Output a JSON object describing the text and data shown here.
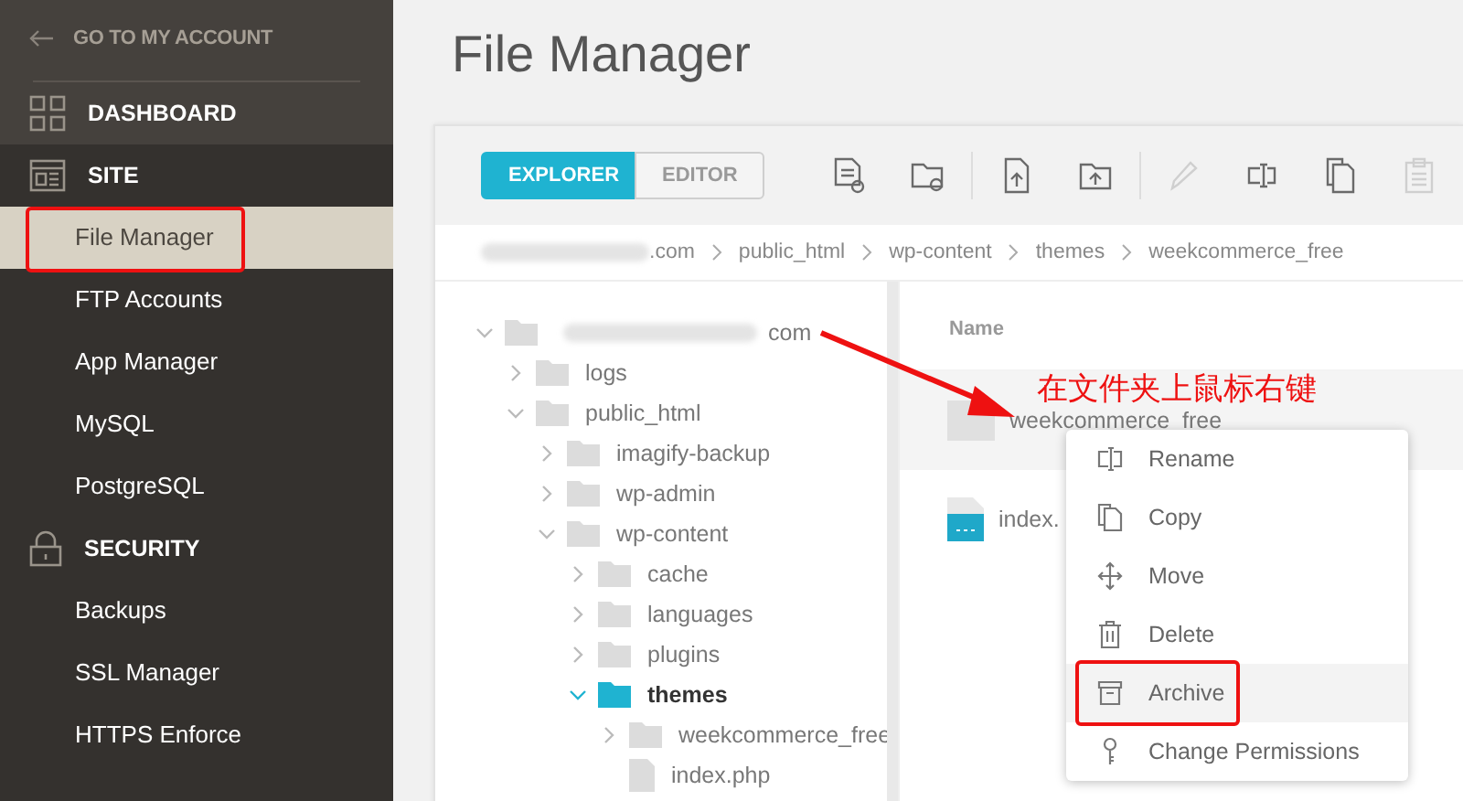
{
  "sidebar": {
    "back_link": "GO TO MY ACCOUNT",
    "top_item": {
      "label": "DASHBOARD",
      "kind": "grid"
    },
    "sections": [
      {
        "label": "SITE",
        "kind": "site",
        "items": [
          {
            "label": "File Manager",
            "selected": true,
            "annotated": true
          },
          {
            "label": "FTP Accounts",
            "selected": false,
            "annotated": false
          },
          {
            "label": "App Manager",
            "selected": false,
            "annotated": false
          },
          {
            "label": "MySQL",
            "selected": false,
            "annotated": false
          },
          {
            "label": "PostgreSQL",
            "selected": false,
            "annotated": false
          }
        ]
      },
      {
        "label": "SECURITY",
        "kind": "lock",
        "items": [
          {
            "label": "Backups",
            "selected": false,
            "annotated": false
          },
          {
            "label": "SSL Manager",
            "selected": false,
            "annotated": false
          },
          {
            "label": "HTTPS Enforce",
            "selected": false,
            "annotated": false
          }
        ]
      }
    ]
  },
  "title": "File Manager",
  "toolbar": {
    "tabs": [
      {
        "label": "EXPLORER",
        "selected": true
      },
      {
        "label": "EDITOR",
        "selected": false
      }
    ],
    "tool_groups": [
      [
        {
          "kind": "new-file",
          "disabled": false
        },
        {
          "kind": "new-folder",
          "disabled": false
        }
      ],
      [
        {
          "kind": "upload-file",
          "disabled": false
        },
        {
          "kind": "upload-folder",
          "disabled": false
        }
      ],
      [
        {
          "kind": "edit",
          "disabled": true
        },
        {
          "kind": "rename",
          "disabled": false
        },
        {
          "kind": "copy",
          "disabled": false
        },
        {
          "kind": "paste",
          "disabled": true
        }
      ]
    ]
  },
  "breadcrumb": [
    {
      "label": ".com",
      "redacted": true
    },
    {
      "label": "public_html",
      "redacted": false
    },
    {
      "label": "wp-content",
      "redacted": false
    },
    {
      "label": "themes",
      "redacted": false
    },
    {
      "label": "weekcommerce_free",
      "redacted": false
    }
  ],
  "tree": {
    "label": "com",
    "kind": "folder",
    "redacted": true,
    "expanded": true,
    "selected": false,
    "children": [
      {
        "label": "logs",
        "kind": "folder",
        "expanded": false,
        "selected": false
      },
      {
        "label": "public_html",
        "kind": "folder",
        "expanded": true,
        "selected": false,
        "children": [
          {
            "label": "imagify-backup",
            "kind": "folder",
            "expanded": false,
            "selected": false
          },
          {
            "label": "wp-admin",
            "kind": "folder",
            "expanded": false,
            "selected": false
          },
          {
            "label": "wp-content",
            "kind": "folder",
            "expanded": true,
            "selected": false,
            "children": [
              {
                "label": "cache",
                "kind": "folder",
                "expanded": false,
                "selected": false
              },
              {
                "label": "languages",
                "kind": "folder",
                "expanded": false,
                "selected": false
              },
              {
                "label": "plugins",
                "kind": "folder",
                "expanded": false,
                "selected": false
              },
              {
                "label": "themes",
                "kind": "folder",
                "expanded": true,
                "selected": true,
                "children": [
                  {
                    "label": "weekcommerce_free",
                    "kind": "folder",
                    "expanded": false,
                    "selected": false
                  },
                  {
                    "label": "index.php",
                    "kind": "file",
                    "selected": false
                  }
                ]
              }
            ]
          }
        ]
      }
    ]
  },
  "files": {
    "header": "Name",
    "rows": [
      {
        "name": "weekcommerce_free",
        "kind": "folder",
        "selected": true
      },
      {
        "name": "index.",
        "kind": "file",
        "selected": false
      }
    ]
  },
  "context_menu": [
    {
      "label": "Rename",
      "kind": "rename",
      "selected": false,
      "annotated": false
    },
    {
      "label": "Copy",
      "kind": "copy",
      "selected": false,
      "annotated": false
    },
    {
      "label": "Move",
      "kind": "move",
      "selected": false,
      "annotated": false
    },
    {
      "label": "Delete",
      "kind": "delete",
      "selected": false,
      "annotated": false
    },
    {
      "label": "Archive",
      "kind": "archive",
      "selected": true,
      "annotated": true
    },
    {
      "label": "Change Permissions",
      "kind": "key",
      "selected": false,
      "annotated": false
    }
  ],
  "annotation": {
    "text": "在文件夹上鼠标右键"
  }
}
